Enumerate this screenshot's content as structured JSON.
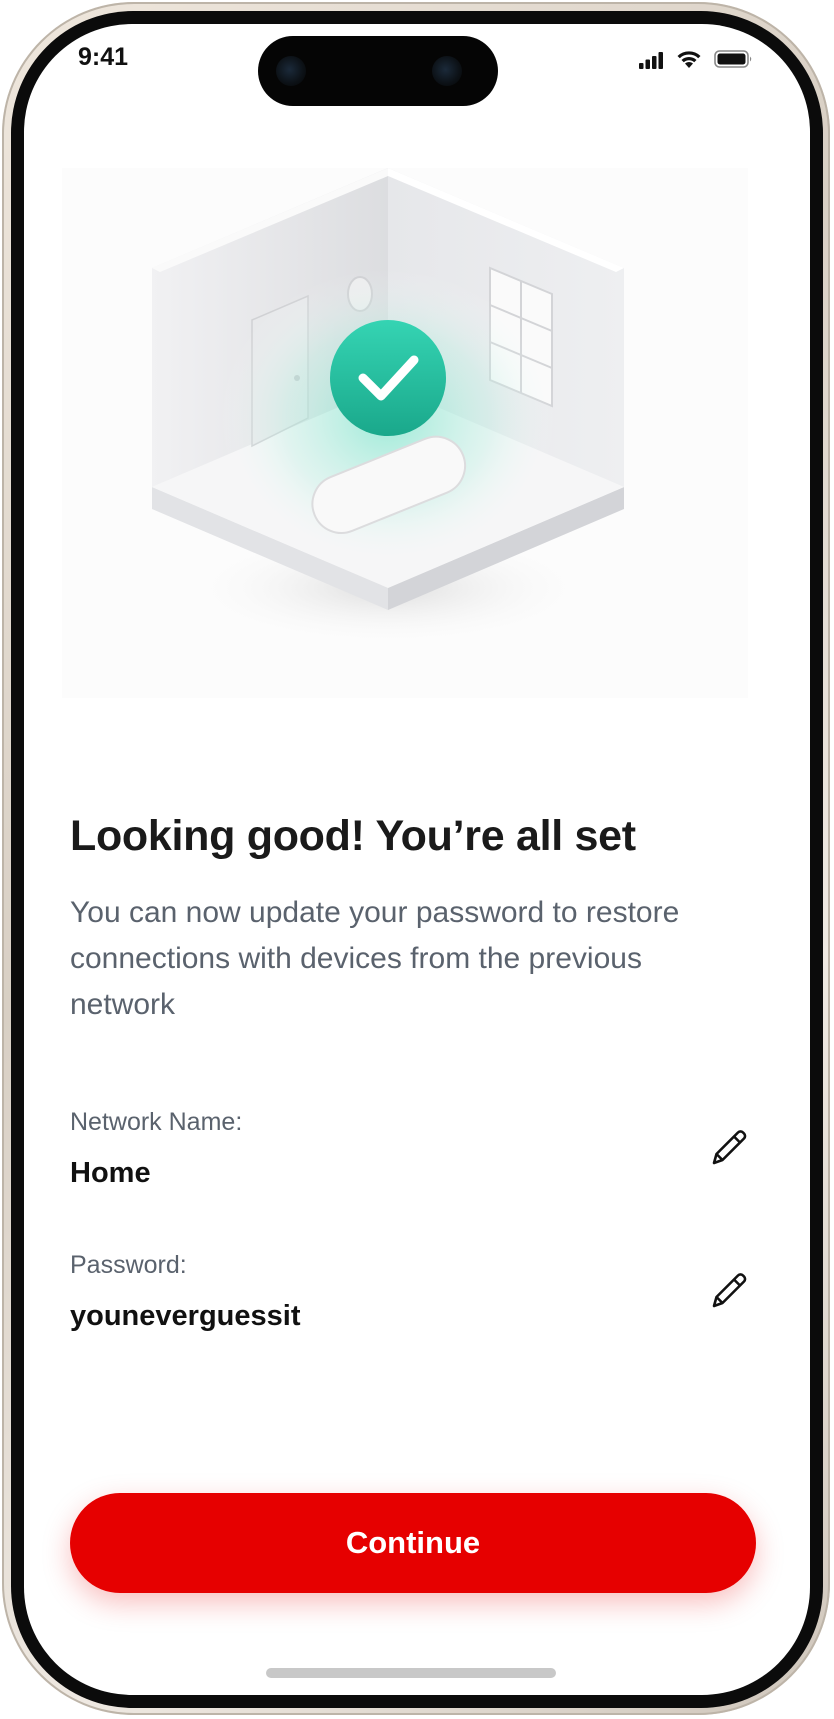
{
  "status_bar": {
    "time": "9:41",
    "signal_icon": "cellular-signal-icon",
    "wifi_icon": "wifi-icon",
    "battery_icon": "battery-icon"
  },
  "hero": {
    "illustration": "isometric-room-with-check-icon",
    "accent_color": "#2cc6a8"
  },
  "content": {
    "title": "Looking good! You’re all set",
    "subtitle": "You can now update your password to restore connections with devices from the previous network"
  },
  "fields": [
    {
      "label": "Network Name:",
      "value": "Home",
      "edit_icon": "pencil-icon"
    },
    {
      "label": "Password:",
      "value": "youneverguessit",
      "edit_icon": "pencil-icon"
    }
  ],
  "actions": {
    "continue_label": "Continue",
    "brand_color": "#e60000"
  }
}
